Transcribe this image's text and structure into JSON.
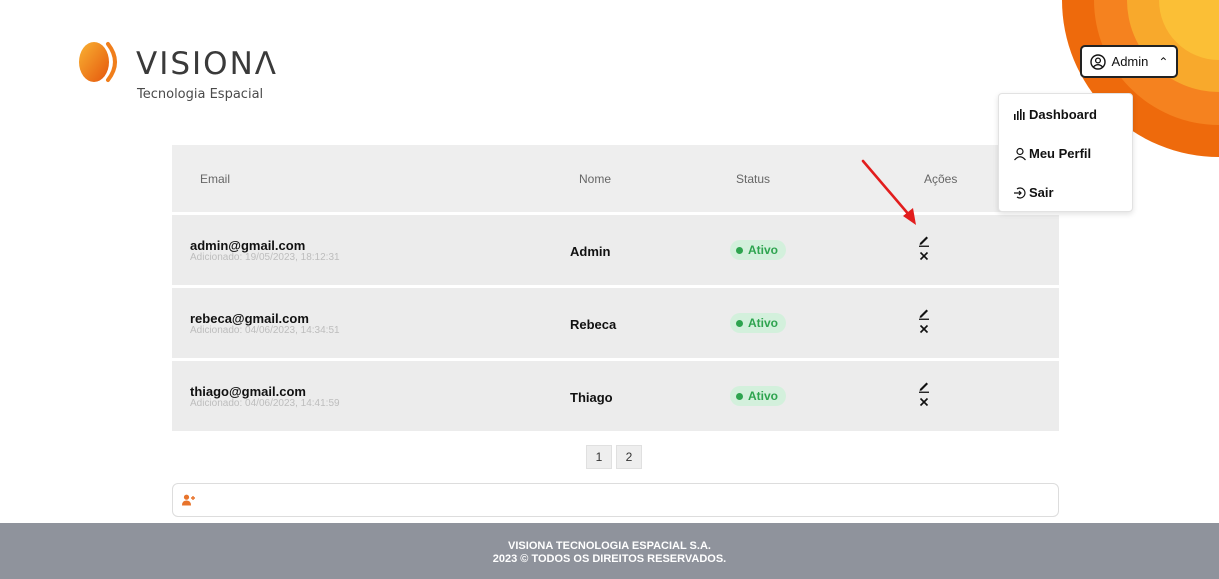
{
  "brand": {
    "name": "VISIONΛ",
    "tagline": "Tecnologia Espacial",
    "colors": {
      "orange": "#f07e1b",
      "dark_orange": "#e96a0b",
      "yellow": "#f7a82a"
    }
  },
  "user_menu": {
    "label": "Admin",
    "icon": "user-circle-icon",
    "items": [
      {
        "label": "Dashboard",
        "icon": "bar-chart-icon"
      },
      {
        "label": "Meu Perfil",
        "icon": "user-icon"
      },
      {
        "label": "Sair",
        "icon": "logout-icon"
      }
    ]
  },
  "table": {
    "columns": [
      "Email",
      "Nome",
      "Status",
      "Ações"
    ],
    "rows": [
      {
        "email": "admin@gmail.com",
        "added": "Adicionado: 19/05/2023, 18:12:31",
        "name": "Admin",
        "status": "Ativo"
      },
      {
        "email": "rebeca@gmail.com",
        "added": "Adicionado: 04/06/2023, 14:34:51",
        "name": "Rebeca",
        "status": "Ativo"
      },
      {
        "email": "thiago@gmail.com",
        "added": "Adicionado: 04/06/2023, 14:41:59",
        "name": "Thiago",
        "status": "Ativo"
      }
    ]
  },
  "pagination": {
    "pages": [
      "1",
      "2"
    ]
  },
  "add_user": {
    "icon": "add-user-icon",
    "color": "#e8742c"
  },
  "footer": {
    "line1": "VISIONA TECNOLOGIA ESPACIAL S.A.",
    "line2": "2023 © TODOS OS DIREITOS RESERVADOS."
  },
  "status_color": "#2ea44f"
}
